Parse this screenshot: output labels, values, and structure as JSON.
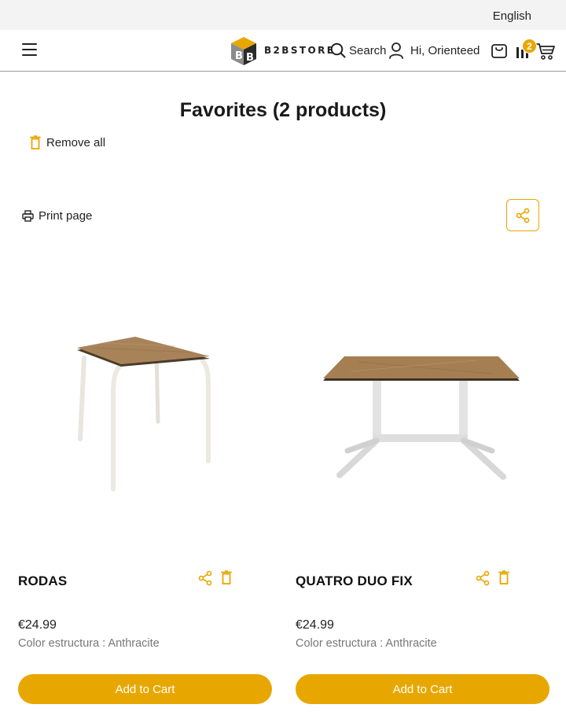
{
  "topbar": {
    "language": "English"
  },
  "header": {
    "brand": "B2BSTORE",
    "search_label": "Search",
    "user_greeting": "Hi, Orienteed",
    "cart_count": "2"
  },
  "page": {
    "title": "Favorites (2 products)",
    "remove_all": "Remove all",
    "print_page": "Print page"
  },
  "products": [
    {
      "name": "RODAS",
      "price": "€24.99",
      "attribute": "Color estructura : Anthracite",
      "add_to_cart": "Add to Cart"
    },
    {
      "name": "QUATRO DUO FIX",
      "price": "€24.99",
      "attribute": "Color estructura : Anthracite",
      "add_to_cart": "Add to Cart"
    }
  ],
  "colors": {
    "accent": "#e8a700",
    "topbar_bg": "#f3f3f4",
    "text": "#1a1a1a",
    "muted": "#777777"
  },
  "icons": [
    "menu-icon",
    "search-icon",
    "user-icon",
    "bag-icon",
    "compare-icon",
    "cart-icon",
    "trash-icon",
    "print-icon",
    "share-icon"
  ]
}
